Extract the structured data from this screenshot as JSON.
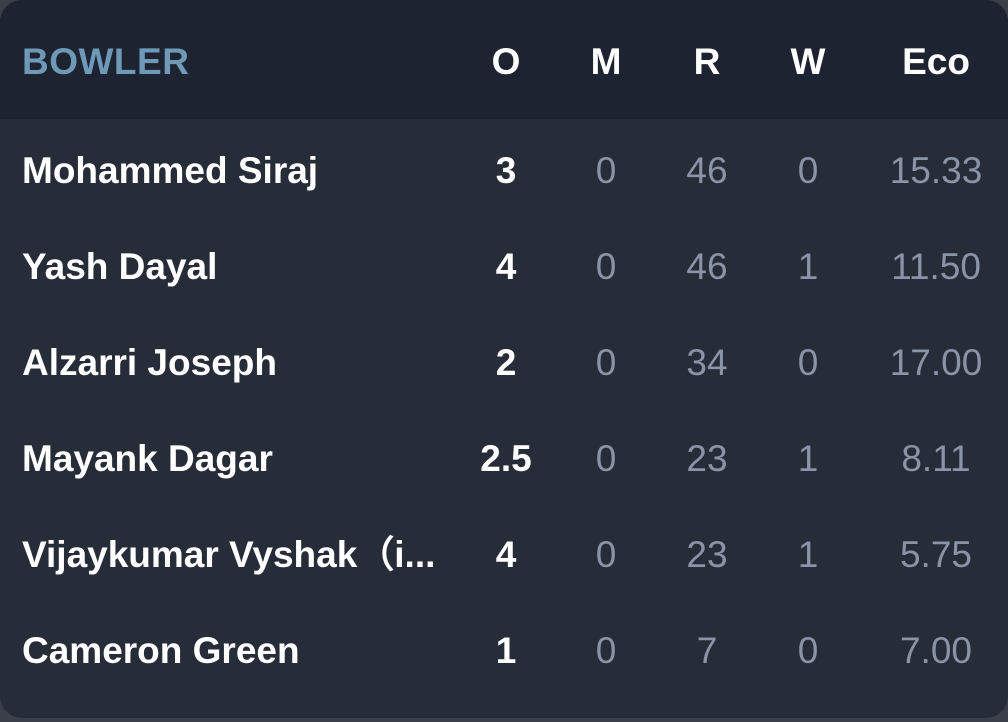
{
  "header": {
    "bowler": "BOWLER",
    "overs": "O",
    "maidens": "M",
    "runs": "R",
    "wickets": "W",
    "economy": "Eco"
  },
  "rows": [
    {
      "name": "Mohammed Siraj",
      "o": "3",
      "m": "0",
      "r": "46",
      "w": "0",
      "eco": "15.33"
    },
    {
      "name": "Yash Dayal",
      "o": "4",
      "m": "0",
      "r": "46",
      "w": "1",
      "eco": "11.50"
    },
    {
      "name": "Alzarri Joseph",
      "o": "2",
      "m": "0",
      "r": "34",
      "w": "0",
      "eco": "17.00"
    },
    {
      "name": "Mayank Dagar",
      "o": "2.5",
      "m": "0",
      "r": "23",
      "w": "1",
      "eco": "8.11"
    },
    {
      "name": "Vijaykumar Vyshak（i...",
      "o": "4",
      "m": "0",
      "r": "23",
      "w": "1",
      "eco": "5.75"
    },
    {
      "name": "Cameron Green",
      "o": "1",
      "m": "0",
      "r": "7",
      "w": "0",
      "eco": "7.00"
    }
  ],
  "colors": {
    "background": "#272d38",
    "header_background": "#1d2330",
    "bowler_header": "#6e9ab8",
    "primary_text": "#ffffff",
    "secondary_text": "#8a93a8"
  }
}
